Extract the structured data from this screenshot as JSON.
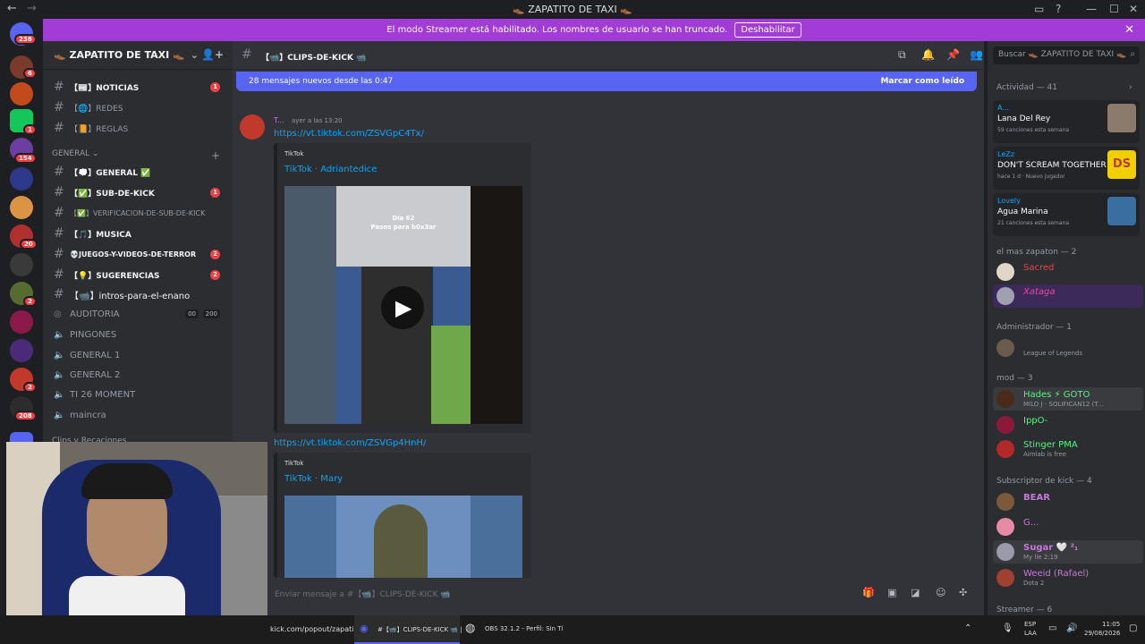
{
  "titlebar": {
    "back": "←",
    "forward": "→",
    "title": "👞 ZAPATITO DE TAXI 👞"
  },
  "banner": {
    "text": "El modo Streamer está habilitado. Los nombres de usuario se han truncado.",
    "button": "Deshabilitar"
  },
  "servers": {
    "top_badge": "238",
    "badges": [
      "6",
      "1",
      "154",
      "20",
      "2",
      "2",
      "208"
    ]
  },
  "guild": {
    "name": "👞 ZAPATITO DE TAXI 👞"
  },
  "channels": [
    {
      "name": "【📰】NOTICIAS",
      "badge": "1",
      "bold": true
    },
    {
      "name": "【🌐】REDES",
      "badge": "",
      "bold": false
    },
    {
      "name": "【📙】REGLAS",
      "badge": "",
      "bold": false
    }
  ],
  "category_general": "GENERAL",
  "general_channels": [
    {
      "name": "【💭】GENERAL ✅",
      "badge": "",
      "bold": true
    },
    {
      "name": "【✅】SUB-DE-KICK",
      "badge": "1",
      "bold": true
    },
    {
      "name": "【✅】VERIFICACION-DE-SUB-DE-KICK",
      "badge": "",
      "bold": false
    },
    {
      "name": "【🎵】MUSICA",
      "badge": "",
      "bold": true
    },
    {
      "name": "💀JUEGOS-Y-VIDEOS-DE-TERROR",
      "badge": "2",
      "bold": true
    },
    {
      "name": "【💡】SUGERENCIAS",
      "badge": "2",
      "bold": true
    },
    {
      "name": "【📹】intros-para-el-enano",
      "badge": "",
      "bold": true
    }
  ],
  "voice_channels": [
    {
      "name": "AUDITORIA",
      "extra1": "00",
      "extra2": "200"
    },
    {
      "name": "PINGONES"
    },
    {
      "name": "GENERAL 1"
    },
    {
      "name": "GENERAL 2"
    },
    {
      "name": "TI 26 MOMENT"
    },
    {
      "name": "maincra"
    }
  ],
  "category_clips": "Clips y Recaciones",
  "header": {
    "channel": "【📹】CLIPS-DE-KICK 📹",
    "search_placeholder": "Buscar 👞 ZAPATITO DE TAXI 👞"
  },
  "newbar": {
    "text": "28 mensajes nuevos desde las 0:47",
    "mark": "Marcar como leído"
  },
  "message": {
    "author": "T...",
    "time": "ayer a las 13:20",
    "link1": "https://vt.tiktok.com/ZSVGpC4Tx/",
    "embed1_provider": "TikTok",
    "embed1_title": "TikTok · Adriantedice",
    "video_overlay_line1": "Día 62",
    "video_overlay_line2": "Pasos para b0x3ar",
    "link2": "https://vt.tiktok.com/ZSVGp4HnH/",
    "embed2_provider": "TikTok",
    "embed2_title": "TikTok · Mary"
  },
  "composer": {
    "placeholder": "Enviar mensaje a #【📹】CLIPS-DE-KICK 📹"
  },
  "activity": {
    "header": "Actividad — 41",
    "items": [
      {
        "name": "A...",
        "title": "Lana Del Rey",
        "sub": "59 canciones esta semana",
        "color": "#8a7b6c"
      },
      {
        "name": "LeZz",
        "title": "DON'T SCREAM TOGETHER",
        "sub": "hace 1 d · Nuevo jugador",
        "art": "DS",
        "color": "#f0d000"
      },
      {
        "name": "Lovely",
        "title": "Agua Marina",
        "sub": "21 canciones esta semana",
        "color": "#3b6ea0"
      }
    ]
  },
  "groups": [
    {
      "label": "el mas zapaton — 2",
      "members": [
        {
          "name": "Sacred",
          "sub": "",
          "color": "#f23f43"
        },
        {
          "name": "Xataga",
          "sub": "",
          "color": "#eb459e"
        }
      ]
    },
    {
      "label": "Administrador — 1",
      "members": [
        {
          "name": "",
          "sub": "League of Legends",
          "color": "#5865f2"
        }
      ]
    },
    {
      "label": "mod — 3",
      "members": [
        {
          "name": "Hades ⚡ GOTO",
          "sub": "MILO J - SOLIFICAN12 (T...",
          "color": "#57f287"
        },
        {
          "name": "IppO-",
          "sub": "",
          "color": "#57f287"
        },
        {
          "name": "Stinger PMA",
          "sub": "Aimlab is free",
          "color": "#57f287"
        }
      ]
    },
    {
      "label": "Subscriptor de kick — 4",
      "members": [
        {
          "name": "BEAR",
          "sub": "",
          "color": "#c678dd"
        },
        {
          "name": "G...",
          "sub": "",
          "color": "#c678dd"
        },
        {
          "name": "Sugar 🤍 ²₁",
          "sub": "My lie 2:19",
          "color": "#c678dd"
        },
        {
          "name": "Weeid (Rafael)",
          "sub": "Dota 2",
          "color": "#c678dd"
        }
      ]
    },
    {
      "label": "Streamer — 6",
      "members": []
    }
  ],
  "taskbar": {
    "url_fragment": "kick.com/popout/zapati",
    "discord_item": "#【📹】CLIPS-DE-KICK 📹 |",
    "obs_item": "OBS 32.1.2 - Perfil: Sin Tí",
    "lang1": "ESP",
    "lang2": "LAA",
    "time": "11:05",
    "date": "29/08/2026"
  }
}
